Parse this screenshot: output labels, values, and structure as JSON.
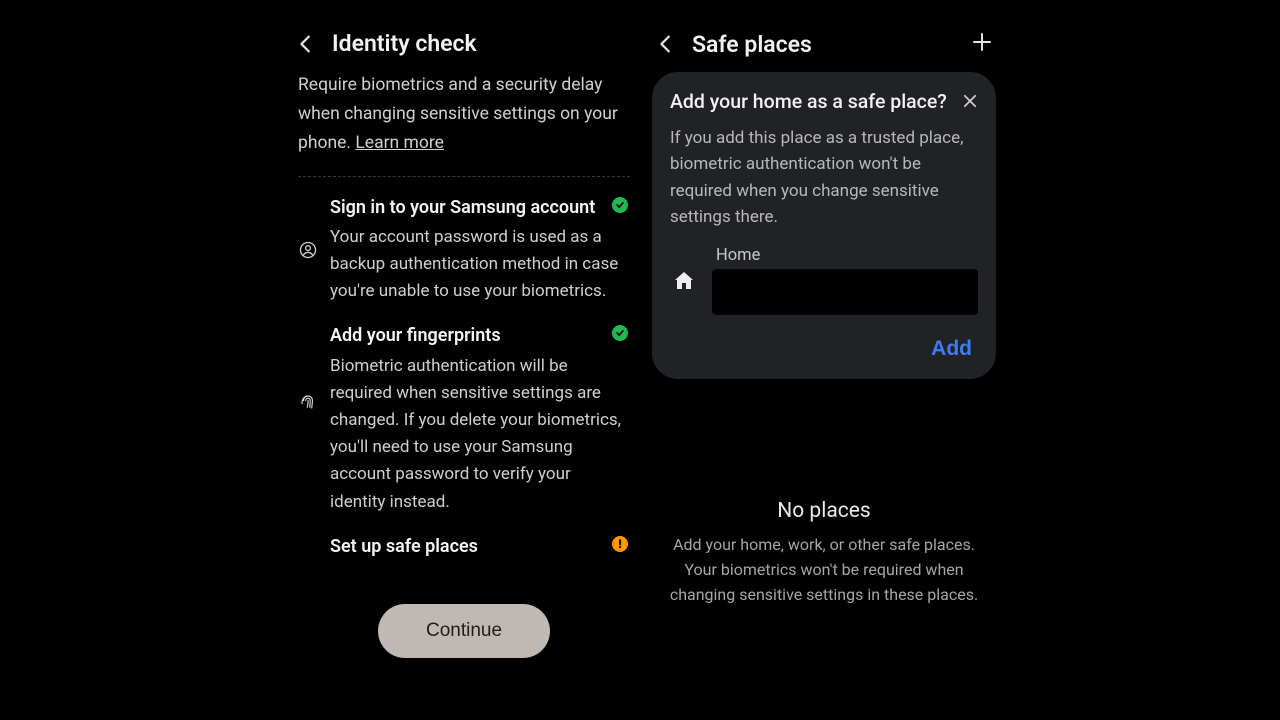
{
  "left": {
    "title": "Identity check",
    "description": "Require biometrics and a security delay when changing sensitive settings on your phone. ",
    "learn_more": "Learn more",
    "steps": [
      {
        "title": "Sign in to your Samsung account",
        "text": "Your account password is used as a backup authentication method in case you're unable to use your biometrics.",
        "status": "done"
      },
      {
        "title": "Add your fingerprints",
        "text": "Biometric authentication will be required when sensitive settings are changed. If you delete your biometrics, you'll need to use your Samsung account password to verify your identity instead.",
        "status": "done"
      },
      {
        "title": "Set up safe places",
        "text": "",
        "status": "warn"
      }
    ],
    "continue_label": "Continue"
  },
  "right": {
    "title": "Safe places",
    "card": {
      "title": "Add your home as a safe place?",
      "text": "If you add this place as a trusted place, biometric authentication won't be required when you change sensitive settings there.",
      "place_label": "Home",
      "add_label": "Add"
    },
    "empty": {
      "title": "No places",
      "text": "Add your home, work, or other safe places. Your biometrics won't be required when changing sensitive settings in these places."
    }
  }
}
